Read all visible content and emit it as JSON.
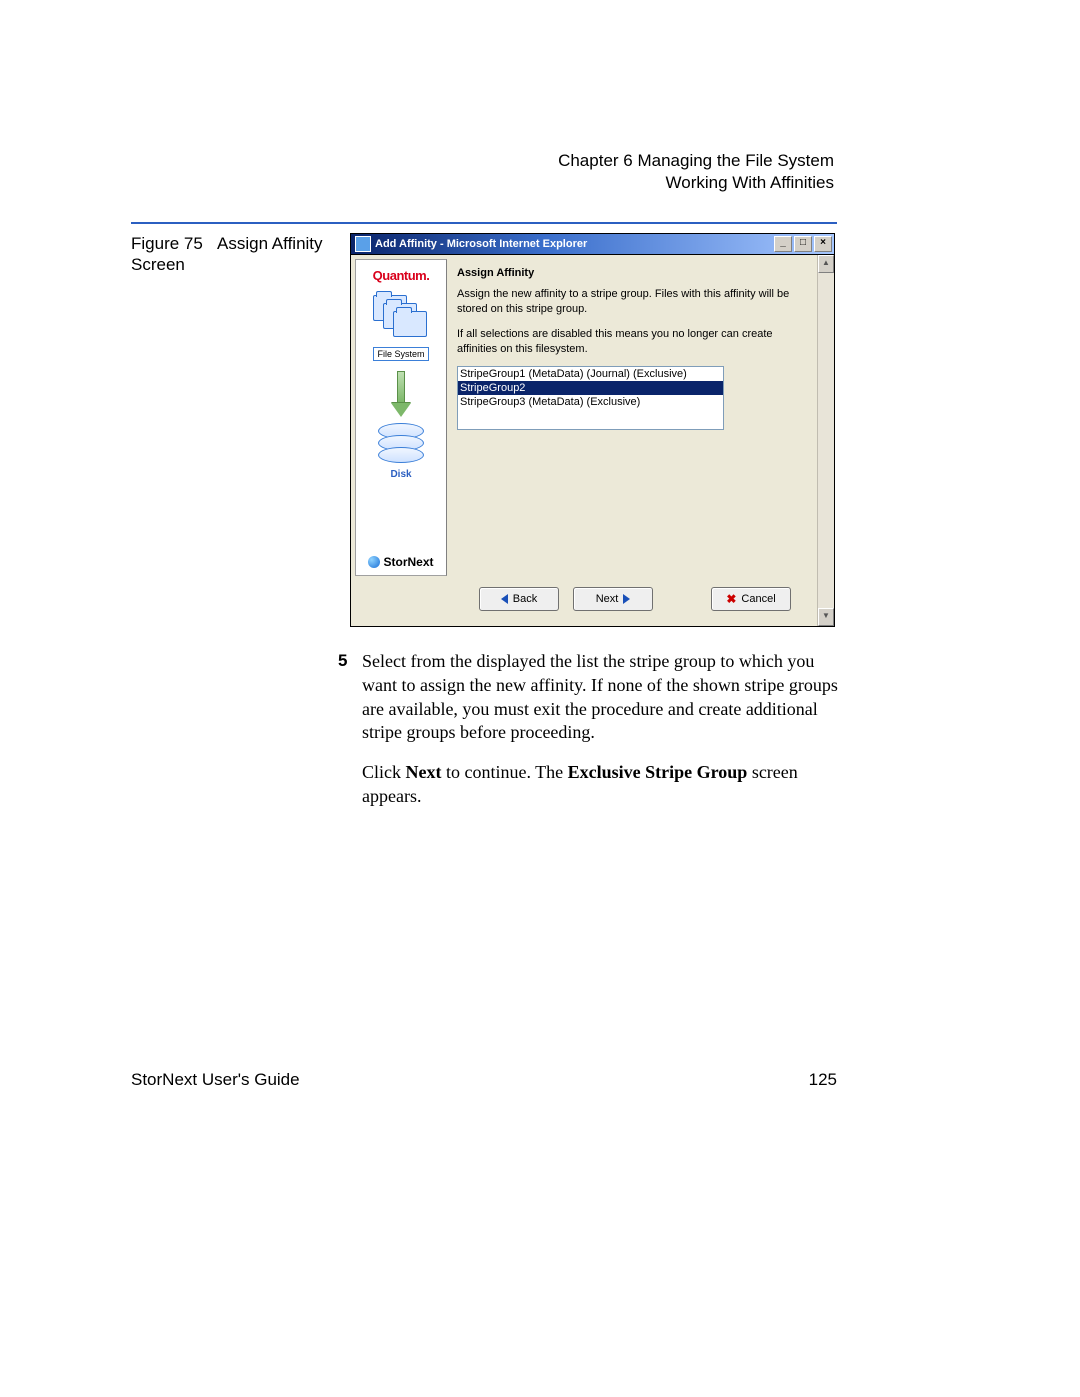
{
  "header": {
    "line1": "Chapter 6  Managing the File System",
    "line2": "Working With Affinities"
  },
  "figure": {
    "label_prefix": "Figure 75",
    "label_suffix": "Assign Affinity Screen"
  },
  "window": {
    "title": "Add Affinity - Microsoft Internet Explorer",
    "brand": "Quantum.",
    "fs_label": "File System",
    "disk_label": "Disk",
    "product": "StorNext",
    "content_heading": "Assign Affinity",
    "para1": "Assign the new affinity to a stripe group. Files with this affinity will be stored on this stripe group.",
    "para2": "If all selections are disabled this means you no longer can create affinities on this filesystem.",
    "options": [
      {
        "label": "StripeGroup1 (MetaData)  (Journal)  (Exclusive)",
        "selected": false
      },
      {
        "label": "StripeGroup2",
        "selected": true
      },
      {
        "label": "StripeGroup3 (MetaData)  (Exclusive)",
        "selected": false
      }
    ],
    "buttons": {
      "back": "Back",
      "next": "Next",
      "cancel": "Cancel"
    }
  },
  "body": {
    "step_num": "5",
    "step_text": "Select from the displayed the list the stripe group to which you want to assign the new affinity. If none of the shown stripe groups are available, you must exit the procedure and create additional stripe groups before proceeding.",
    "after_pre": "Click ",
    "after_b1": "Next",
    "after_mid": " to continue. The ",
    "after_b2": "Exclusive Stripe Group",
    "after_post": " screen appears."
  },
  "footer": {
    "left": "StorNext User's Guide",
    "right": "125"
  }
}
